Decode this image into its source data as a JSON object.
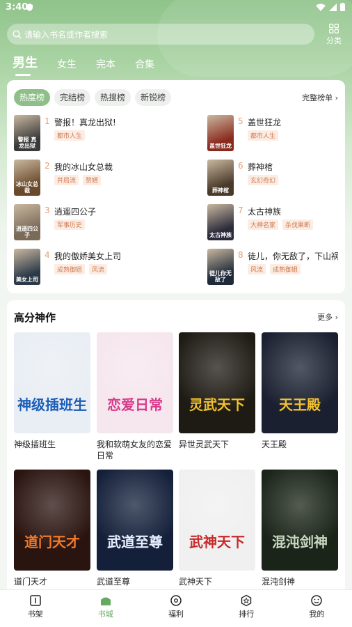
{
  "status": {
    "time": "3:40"
  },
  "search": {
    "placeholder": "请输入书名或作者搜索"
  },
  "category": {
    "label": "分类"
  },
  "tabs": [
    "男生",
    "女生",
    "完本",
    "合集"
  ],
  "ranking": {
    "chips": [
      "热度榜",
      "完结榜",
      "热搜榜",
      "新锐榜"
    ],
    "full_label": "完整榜单",
    "items": [
      {
        "num": "1",
        "title": "警报！真龙出狱!",
        "tags": [
          "都市人生"
        ],
        "cover_text": "警报 真龙出狱",
        "cover_color": "#3a3a3a"
      },
      {
        "num": "2",
        "title": "我的冰山女总裁",
        "tags": [
          "井局流",
          "赘婿"
        ],
        "cover_text": "冰山女总裁",
        "cover_color": "#6b4a2c"
      },
      {
        "num": "3",
        "title": "逍遥四公子",
        "tags": [
          "军事历史"
        ],
        "cover_text": "逍遥四公子",
        "cover_color": "#7a6a58"
      },
      {
        "num": "4",
        "title": "我的傲娇美女上司",
        "tags": [
          "成熟御姐",
          "风流"
        ],
        "cover_text": "美女上司",
        "cover_color": "#2c3a48"
      },
      {
        "num": "5",
        "title": "盖世狂龙",
        "tags": [
          "都市人生"
        ],
        "cover_text": "盖世狂龙",
        "cover_color": "#8a2a1e"
      },
      {
        "num": "6",
        "title": "葬神棺",
        "tags": [
          "玄幻奇幻"
        ],
        "cover_text": "葬神棺",
        "cover_color": "#4a3a2a"
      },
      {
        "num": "7",
        "title": "太古神族",
        "tags": [
          "大神名家",
          "杀伐果断"
        ],
        "cover_text": "太古神族",
        "cover_color": "#2a2a3a"
      },
      {
        "num": "8",
        "title": "徒儿，你无敌了，下山祸",
        "tags": [
          "风流",
          "成熟御姐"
        ],
        "cover_text": "徒儿你无敌了",
        "cover_color": "#1e2a38"
      }
    ]
  },
  "high_score": {
    "title": "高分神作",
    "more_label": "更多",
    "books": [
      {
        "title": "神级插班生",
        "cover_text": "神级插班生",
        "author_line": "",
        "bg": "#e9eef4",
        "fg": "#1a5db8"
      },
      {
        "title": "我和软萌女友的恋爱日常",
        "cover_text": "恋爱日常",
        "author_line": "",
        "bg": "#f6e6ee",
        "fg": "#d83a8a"
      },
      {
        "title": "异世灵武天下",
        "cover_text": "灵武天下",
        "author_line": "",
        "bg": "#1e1a14",
        "fg": "#f2c12e"
      },
      {
        "title": "天王殿",
        "cover_text": "天王殿",
        "author_line": "",
        "bg": "#1a2030",
        "fg": "#f2c12e"
      },
      {
        "title": "道门天才",
        "cover_text": "道门天才",
        "author_line": "",
        "bg": "#2a1410",
        "fg": "#f07a2a"
      },
      {
        "title": "武道至尊",
        "cover_text": "武道至尊",
        "author_line": "",
        "bg": "#14203a",
        "fg": "#e8f0ff"
      },
      {
        "title": "武神天下",
        "cover_text": "武神天下",
        "author_line": "",
        "bg": "#f0f0f0",
        "fg": "#c8282a"
      },
      {
        "title": "混沌剑神",
        "cover_text": "混沌剑神",
        "author_line": "",
        "bg": "#1a2418",
        "fg": "#c8d8c0"
      }
    ]
  },
  "bottom_nav": [
    {
      "label": "书架",
      "icon": "bookshelf-icon"
    },
    {
      "label": "书城",
      "icon": "bookstore-icon",
      "active": true
    },
    {
      "label": "福利",
      "icon": "welfare-icon"
    },
    {
      "label": "排行",
      "icon": "ranking-icon"
    },
    {
      "label": "我的",
      "icon": "profile-icon"
    }
  ],
  "colors": {
    "accent": "#67a862",
    "chip_active": "#8fbf89",
    "rank_num": "#e8a070",
    "tag_text": "#d07a52"
  }
}
